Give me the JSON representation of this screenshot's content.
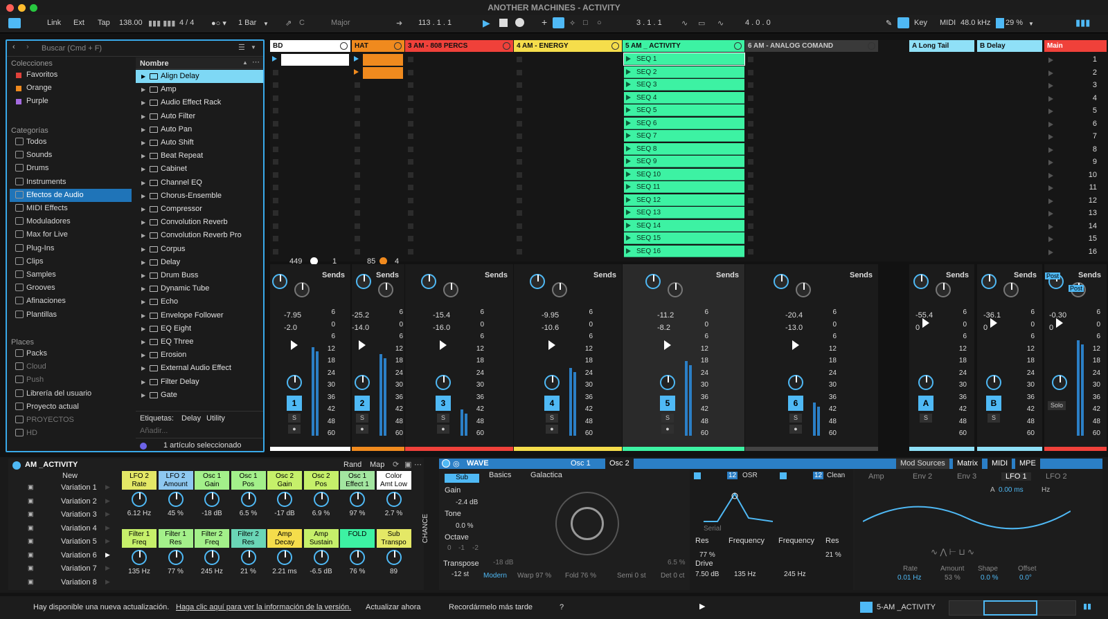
{
  "title": "ANOTHER MACHINES - ACTIVITY",
  "control": {
    "link": "Link",
    "ext": "Ext",
    "tap": "Tap",
    "tempo": "138.00",
    "sig": "4 / 4",
    "quant": "1 Bar",
    "key_note": "C",
    "scale": "Major",
    "position": "113 .  1 .  1",
    "loop_start": "3 .  1 .  1",
    "loop_len": "4 .  0 .  0",
    "key": "Key",
    "midi": "MIDI",
    "rate": "48.0 kHz",
    "cpu": "29 %"
  },
  "browser": {
    "search": "Buscar (Cmd + F)",
    "col_header": "Nombre",
    "sections": {
      "collections": "Colecciones",
      "categories": "Categorías",
      "places": "Places"
    },
    "collections": [
      {
        "label": "Favoritos",
        "color": "#e0413a"
      },
      {
        "label": "Orange",
        "color": "#f08a1e"
      },
      {
        "label": "Purple",
        "color": "#a56be0"
      }
    ],
    "categories": [
      "Todos",
      "Sounds",
      "Drums",
      "Instruments",
      "Efectos de Audio",
      "MIDI Effects",
      "Moduladores",
      "Max for Live",
      "Plug-Ins",
      "Clips",
      "Samples",
      "Grooves",
      "Afinaciones",
      "Plantillas"
    ],
    "places": [
      "Packs",
      "Cloud",
      "Push",
      "Librería del usuario",
      "Proyecto actual",
      "PROYECTOS",
      "HD"
    ],
    "items": [
      "Align Delay",
      "Amp",
      "Audio Effect Rack",
      "Auto Filter",
      "Auto Pan",
      "Auto Shift",
      "Beat Repeat",
      "Cabinet",
      "Channel EQ",
      "Chorus-Ensemble",
      "Compressor",
      "Convolution Reverb",
      "Convolution Reverb Pro",
      "Corpus",
      "Delay",
      "Drum Buss",
      "Dynamic Tube",
      "Echo",
      "Envelope Follower",
      "EQ Eight",
      "EQ Three",
      "Erosion",
      "External Audio Effect",
      "Filter Delay",
      "Gate"
    ],
    "tags_label": "Etiquetas:",
    "tags": [
      "Delay",
      "Utility"
    ],
    "add": "Añadir...",
    "selected": "1 artículo seleccionado"
  },
  "tracks": [
    {
      "name": "BD",
      "color": "#ffffff",
      "num": "1",
      "vol": "-7.95",
      "pan": "-2.0"
    },
    {
      "name": "HAT",
      "color": "#f08a1e",
      "num": "2",
      "vol": "-25.2",
      "pan": "-14.0"
    },
    {
      "name": "3 AM - 808 PERCS",
      "color": "#f0413a",
      "num": "3",
      "vol": "-15.4",
      "pan": "-16.0"
    },
    {
      "name": "4 AM - ENERGY",
      "color": "#f5dd4b",
      "num": "4",
      "vol": "-9.95",
      "pan": "-10.6"
    },
    {
      "name": "5 AM _ ACTIVITY",
      "color": "#3df2a3",
      "num": "5",
      "vol": "-11.2",
      "pan": "-8.2"
    },
    {
      "name": "6 AM - ANALOG COMAND",
      "color": "#2d2d2d",
      "num": "6",
      "vol": "-20.4",
      "pan": "-13.0"
    }
  ],
  "returns": [
    {
      "name": "A Long Tail",
      "num": "A",
      "vol": "-55.4",
      "pan": "0"
    },
    {
      "name": "B Delay",
      "num": "B",
      "vol": "-36.1",
      "pan": "0"
    }
  ],
  "main": {
    "name": "Main",
    "vol": "-0.30",
    "pan": "0",
    "solo": "Solo",
    "post": "Post"
  },
  "clips": [
    "SEQ 1",
    "SEQ 2",
    "SEQ 3",
    "SEQ 4",
    "SEQ 5",
    "SEQ 6",
    "SEQ 7",
    "SEQ 8",
    "SEQ 9",
    "SEQ 10",
    "SEQ 11",
    "SEQ 12",
    "SEQ 13",
    "SEQ 14",
    "SEQ 15",
    "SEQ 16"
  ],
  "scenes": [
    "1",
    "2",
    "3",
    "4",
    "5",
    "6",
    "7",
    "8",
    "9",
    "10",
    "11",
    "12",
    "13",
    "14",
    "15",
    "16"
  ],
  "bd_info": {
    "a": "449",
    "b": "1"
  },
  "hat_info": {
    "a": "85",
    "b": "4"
  },
  "sends": "Sends",
  "scale_marks": [
    "6",
    "0",
    "6",
    "12",
    "18",
    "24",
    "30",
    "36",
    "42",
    "48",
    "60"
  ],
  "device": {
    "rack_name": "AM _ACTIVITY",
    "rand": "Rand",
    "map": "Map",
    "new": "New",
    "variations": [
      "Variation 1",
      "Variation 2",
      "Variation 3",
      "Variation 4",
      "Variation 5",
      "Variation 6",
      "Variation 7",
      "Variation 8"
    ],
    "macros_top": [
      {
        "l": "LFO 2\nRate",
        "v": "6.12 Hz",
        "c": "#e4e866"
      },
      {
        "l": "LFO 2\nAmount",
        "v": "45 %",
        "c": "#8ec8f0"
      },
      {
        "l": "Osc 1\nGain",
        "v": "-18 dB",
        "c": "#a3f08a"
      },
      {
        "l": "Osc 1\nPos",
        "v": "6.5 %",
        "c": "#a3f08a"
      },
      {
        "l": "Osc 2\nGain",
        "v": "-17 dB",
        "c": "#c6f06a"
      },
      {
        "l": "Osc 2\nPos",
        "v": "6.9 %",
        "c": "#c6f06a"
      },
      {
        "l": "Osc 1\nEffect 1",
        "v": "97 %",
        "c": "#a3e6a0"
      },
      {
        "l": "Color\nAmt Low",
        "v": "2.7 %",
        "c": "#ffffff"
      }
    ],
    "macros_bot": [
      {
        "l": "Filter 1\nFreq",
        "v": "135 Hz",
        "c": "#c6f06a"
      },
      {
        "l": "Filter 1\nRes",
        "v": "77 %",
        "c": "#a3f08a"
      },
      {
        "l": "Filter 2\nFreq",
        "v": "245 Hz",
        "c": "#a3f08a"
      },
      {
        "l": "Filter 2\nRes",
        "v": "21 %",
        "c": "#6ad6b6"
      },
      {
        "l": "Amp\nDecay",
        "v": "2.21 ms",
        "c": "#f5dd4b"
      },
      {
        "l": "Amp\nSustain",
        "v": "-6.5 dB",
        "c": "#c6f06a"
      },
      {
        "l": "FOLD",
        "v": "76 %",
        "c": "#3df2a3"
      },
      {
        "l": "Sub\nTranspo",
        "v": "89",
        "c": "#e4e866"
      }
    ],
    "chance": "CHANCE",
    "wave": {
      "name": "WAVE",
      "sub": "Sub",
      "gain": "Gain",
      "gain_v": "-2.4 dB",
      "tone": "Tone",
      "tone_v": "0.0 %",
      "octave": "Octave",
      "oct_vals": [
        "0",
        "-1",
        "-2"
      ],
      "transpose": "Transpose",
      "transpose_v": "-12 st",
      "osc1": "Osc 1",
      "osc2": "Osc 2",
      "basics": "Basics",
      "galactica": "Galactica",
      "db": "-18 dB",
      "pct": "6.5 %",
      "modern": "Modern",
      "warp": "Warp 97 %",
      "fold": "Fold 76 %",
      "semi": "Semi 0 st",
      "det": "Det 0 ct",
      "osr": "OSR",
      "clean": "Clean",
      "twelve": "12",
      "serial": "Serial",
      "res": "Res",
      "res_v": "77 %",
      "freq": "Frequency",
      "freq1_v": "135 Hz",
      "freq2": "Frequency",
      "freq2_v": "245 Hz",
      "res2": "Res",
      "res2_v": "21 %",
      "drive": "Drive",
      "drive_v": "7.50 dB"
    },
    "mod": {
      "tabs": [
        "Mod Sources",
        "Matrix",
        "MIDI",
        "MPE"
      ],
      "sub": [
        "Amp",
        "Env 2",
        "Env 3",
        "LFO 1",
        "LFO 2"
      ],
      "a": "A",
      "time": "0.00 ms",
      "hz": "Hz",
      "rate": "Rate",
      "rate_v": "0.01 Hz",
      "amount": "Amount",
      "amount_v": "53 %",
      "shape": "Shape",
      "shape_v": "0.0 %",
      "offset": "Offset",
      "offset_v": "0.0°"
    }
  },
  "status": {
    "msg": "Hay disponible una nueva actualización.",
    "link": "Haga clic aquí para ver la información de la versión.",
    "now": "Actualizar ahora",
    "later": "Recordármelo más tarde",
    "q": "?",
    "track": "5-AM _ACTIVITY"
  }
}
